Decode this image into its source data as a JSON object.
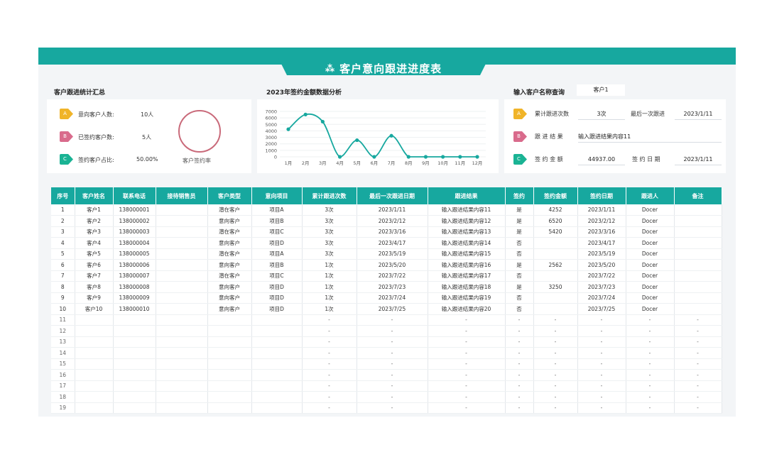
{
  "title": "客户意向跟进进度表",
  "colors": {
    "accent": "#17a89f",
    "badge_a": "#f0b429",
    "badge_b": "#d96b8c",
    "badge_c": "#1ab394",
    "ring": "#c96a7a"
  },
  "summary": {
    "title": "客户跟进统计汇总",
    "rows": [
      {
        "badge": "A",
        "label": "意向客户人数:",
        "value": "10人"
      },
      {
        "badge": "B",
        "label": "已签约客户数:",
        "value": "5人"
      },
      {
        "badge": "C",
        "label": "签约客户占比:",
        "value": "50.00%"
      }
    ],
    "ring_label": "客户签约率"
  },
  "chart_section_title": "2023年签约金额数据分析",
  "chart_data": {
    "type": "line",
    "title": "2023年签约金额数据分析",
    "categories": [
      "1月",
      "2月",
      "3月",
      "4月",
      "5月",
      "6月",
      "7月",
      "8月",
      "9月",
      "10月",
      "11月",
      "12月"
    ],
    "values": [
      4252,
      6520,
      5420,
      0,
      2562,
      0,
      3250,
      0,
      0,
      0,
      0,
      0
    ],
    "yticks": [
      "7000",
      "6000",
      "5000",
      "4000",
      "3000",
      "2000",
      "1000",
      "0"
    ],
    "ylim": [
      0,
      7000
    ],
    "grid": true,
    "color": "#17a89f"
  },
  "query": {
    "title": "输入客户名称查询",
    "customer": "客户1",
    "rows": [
      {
        "badge": "A",
        "label": "累计跟进次数",
        "value": "3次",
        "label2": "最后一次跟进",
        "value2": "2023/1/11"
      },
      {
        "badge": "B",
        "label": "跟 进 结 果",
        "value": "输入跟进结果内容11"
      },
      {
        "badge": "C",
        "label": "签 约 金 额",
        "value": "44937.00",
        "label2": "签 约 日 期",
        "value2": "2023/1/11"
      }
    ]
  },
  "table": {
    "headers": [
      "序号",
      "客户姓名",
      "联系电话",
      "接待销售员",
      "客户类型",
      "意向项目",
      "累计跟进次数",
      "最后一次跟进日期",
      "跟进结果",
      "签约",
      "签约金额",
      "签约日期",
      "跟进人",
      "备注"
    ],
    "rows": [
      [
        "1",
        "客户1",
        "138000001",
        "",
        "潜在客户",
        "项目A",
        "3次",
        "2023/1/11",
        "输入跟进结果内容11",
        "是",
        "4252",
        "2023/1/11",
        "Docer",
        ""
      ],
      [
        "2",
        "客户2",
        "138000002",
        "",
        "意向客户",
        "项目B",
        "3次",
        "2023/2/12",
        "输入跟进结果内容12",
        "是",
        "6520",
        "2023/2/12",
        "Docer",
        ""
      ],
      [
        "3",
        "客户3",
        "138000003",
        "",
        "潜在客户",
        "项目C",
        "3次",
        "2023/3/16",
        "输入跟进结果内容13",
        "是",
        "5420",
        "2023/3/16",
        "Docer",
        ""
      ],
      [
        "4",
        "客户4",
        "138000004",
        "",
        "意向客户",
        "项目D",
        "3次",
        "2023/4/17",
        "输入跟进结果内容14",
        "否",
        "",
        "2023/4/17",
        "Docer",
        ""
      ],
      [
        "5",
        "客户5",
        "138000005",
        "",
        "潜在客户",
        "项目A",
        "3次",
        "2023/5/19",
        "输入跟进结果内容15",
        "否",
        "",
        "2023/5/19",
        "Docer",
        ""
      ],
      [
        "6",
        "客户6",
        "138000006",
        "",
        "意向客户",
        "项目B",
        "1次",
        "2023/5/20",
        "输入跟进结果内容16",
        "是",
        "2562",
        "2023/5/20",
        "Docer",
        ""
      ],
      [
        "7",
        "客户7",
        "138000007",
        "",
        "潜在客户",
        "项目C",
        "1次",
        "2023/7/22",
        "输入跟进结果内容17",
        "否",
        "",
        "2023/7/22",
        "Docer",
        ""
      ],
      [
        "8",
        "客户8",
        "138000008",
        "",
        "意向客户",
        "项目D",
        "1次",
        "2023/7/23",
        "输入跟进结果内容18",
        "是",
        "3250",
        "2023/7/23",
        "Docer",
        ""
      ],
      [
        "9",
        "客户9",
        "138000009",
        "",
        "意向客户",
        "项目D",
        "1次",
        "2023/7/24",
        "输入跟进结果内容19",
        "否",
        "",
        "2023/7/24",
        "Docer",
        ""
      ],
      [
        "10",
        "客户10",
        "138000010",
        "",
        "意向客户",
        "项目D",
        "1次",
        "2023/7/25",
        "输入跟进结果内容20",
        "否",
        "",
        "2023/7/25",
        "Docer",
        ""
      ],
      [
        "11",
        "",
        "",
        "",
        "",
        "",
        "-",
        "-",
        "-",
        "-",
        "-",
        "-",
        "-",
        "-"
      ],
      [
        "12",
        "",
        "",
        "",
        "",
        "",
        "-",
        "-",
        "-",
        "-",
        "-",
        "-",
        "-",
        "-"
      ],
      [
        "13",
        "",
        "",
        "",
        "",
        "",
        "-",
        "-",
        "-",
        "-",
        "-",
        "-",
        "-",
        "-"
      ],
      [
        "14",
        "",
        "",
        "",
        "",
        "",
        "-",
        "-",
        "-",
        "-",
        "-",
        "-",
        "-",
        "-"
      ],
      [
        "15",
        "",
        "",
        "",
        "",
        "",
        "-",
        "-",
        "-",
        "-",
        "-",
        "-",
        "-",
        "-"
      ],
      [
        "16",
        "",
        "",
        "",
        "",
        "",
        "-",
        "-",
        "-",
        "-",
        "-",
        "-",
        "-",
        "-"
      ],
      [
        "17",
        "",
        "",
        "",
        "",
        "",
        "-",
        "-",
        "-",
        "-",
        "-",
        "-",
        "-",
        "-"
      ],
      [
        "18",
        "",
        "",
        "",
        "",
        "",
        "-",
        "-",
        "-",
        "-",
        "-",
        "-",
        "-",
        "-"
      ],
      [
        "19",
        "",
        "",
        "",
        "",
        "",
        "-",
        "-",
        "-",
        "-",
        "-",
        "-",
        "-",
        "-"
      ]
    ]
  }
}
